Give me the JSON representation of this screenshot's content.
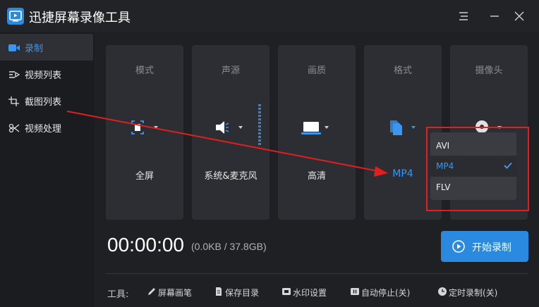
{
  "window": {
    "title": "迅捷屏幕录像工具",
    "accent_color": "#2a8ae0"
  },
  "sidebar": {
    "items": [
      {
        "label": "录制",
        "icon": "camera-icon",
        "active": true
      },
      {
        "label": "视频列表",
        "icon": "video-list-icon",
        "active": false
      },
      {
        "label": "截图列表",
        "icon": "screenshot-list-icon",
        "active": false
      },
      {
        "label": "视频处理",
        "icon": "video-process-icon",
        "active": false
      }
    ]
  },
  "cards": [
    {
      "title": "模式",
      "value": "全屏",
      "icon": "fullscreen-icon"
    },
    {
      "title": "声源",
      "value": "系统&麦克风",
      "icon": "speaker-icon"
    },
    {
      "title": "画质",
      "value": "高清",
      "icon": "laptop-icon"
    },
    {
      "title": "格式",
      "value": "MP4",
      "icon": "file-format-icon"
    },
    {
      "title": "摄像头",
      "value": "",
      "icon": "webcam-icon"
    }
  ],
  "format_dropdown": {
    "options": [
      "AVI",
      "MP4",
      "FLV"
    ],
    "selected": "MP4"
  },
  "timer": {
    "time": "00:00:00",
    "size": "(0.0KB / 37.8GB)"
  },
  "record_button": {
    "label": "开始录制"
  },
  "tools": {
    "label": "工具:",
    "items": [
      {
        "label": "屏幕画笔",
        "icon": "pen-icon"
      },
      {
        "label": "保存目录",
        "icon": "folder-icon"
      },
      {
        "label": "水印设置",
        "icon": "watermark-icon"
      },
      {
        "label": "自动停止(关)",
        "icon": "pause-icon"
      },
      {
        "label": "定时录制(关)",
        "icon": "clock-icon"
      }
    ]
  }
}
